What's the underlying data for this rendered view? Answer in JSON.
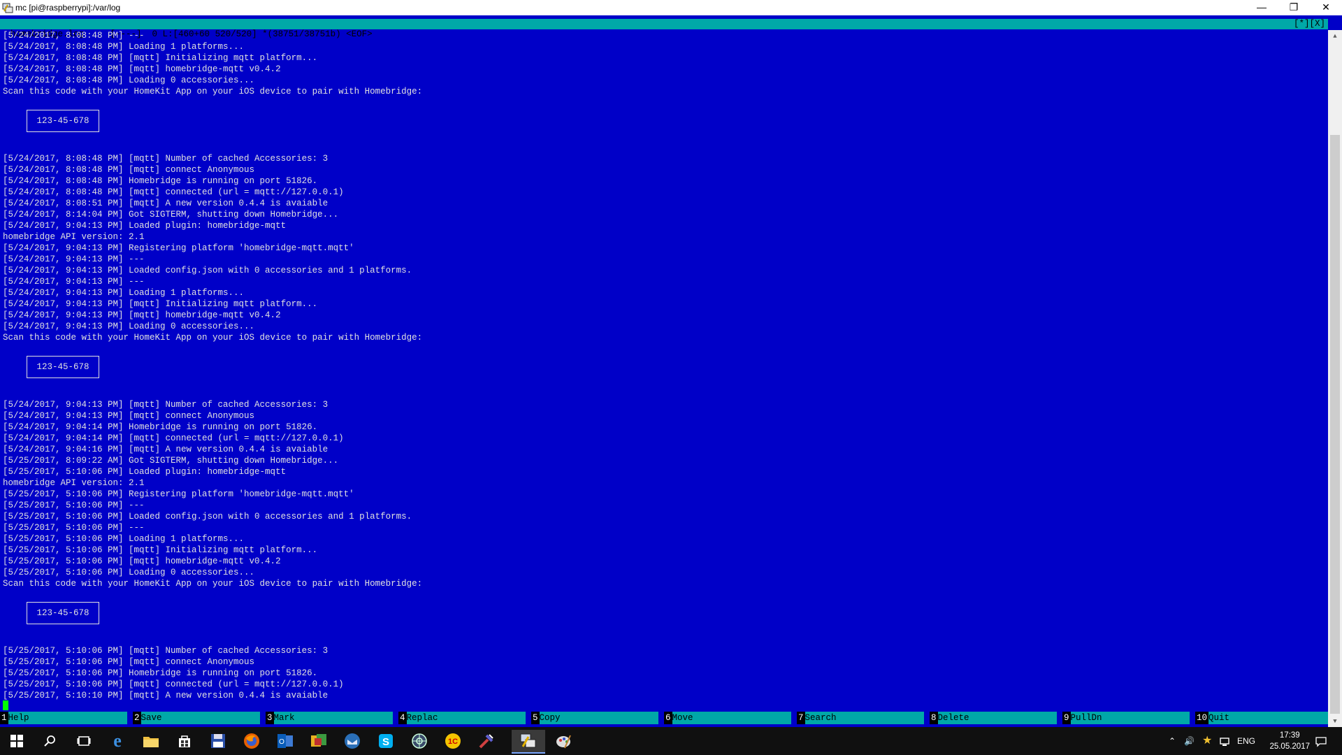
{
  "window": {
    "title": "mc [pi@raspberrypi]:/var/log",
    "controls": [
      "minimize",
      "restore",
      "close"
    ]
  },
  "status": {
    "left": "homebridge.log     [----]  0 L:[460+60 520/520] *(38751/38751b) <EOF>",
    "right": "[*][X]"
  },
  "log": [
    {
      "t": "[5/24/2017, 8:08:48 PM] ---"
    },
    {
      "t": "[5/24/2017, 8:08:48 PM] Loading 1 platforms..."
    },
    {
      "t": "[5/24/2017, 8:08:48 PM] [mqtt] Initializing mqtt platform..."
    },
    {
      "t": "[5/24/2017, 8:08:48 PM] [mqtt] homebridge-mqtt v0.4.2"
    },
    {
      "t": "[5/24/2017, 8:08:48 PM] Loading 0 accessories..."
    },
    {
      "t": "Scan this code with your HomeKit App on your iOS device to pair with Homebridge:"
    },
    {
      "qr": "123-45-678"
    },
    {
      "t": "[5/24/2017, 8:08:48 PM] [mqtt] Number of cached Accessories: 3"
    },
    {
      "t": "[5/24/2017, 8:08:48 PM] [mqtt] connect Anonymous"
    },
    {
      "t": "[5/24/2017, 8:08:48 PM] Homebridge is running on port 51826."
    },
    {
      "t": "[5/24/2017, 8:08:48 PM] [mqtt] connected (url = mqtt://127.0.0.1)"
    },
    {
      "t": "[5/24/2017, 8:08:51 PM] [mqtt] A new version 0.4.4 is avaiable"
    },
    {
      "t": "[5/24/2017, 8:14:04 PM] Got SIGTERM, shutting down Homebridge..."
    },
    {
      "t": "[5/24/2017, 9:04:13 PM] Loaded plugin: homebridge-mqtt"
    },
    {
      "t": "homebridge API version: 2.1"
    },
    {
      "t": "[5/24/2017, 9:04:13 PM] Registering platform 'homebridge-mqtt.mqtt'"
    },
    {
      "t": "[5/24/2017, 9:04:13 PM] ---"
    },
    {
      "t": "[5/24/2017, 9:04:13 PM] Loaded config.json with 0 accessories and 1 platforms."
    },
    {
      "t": "[5/24/2017, 9:04:13 PM] ---"
    },
    {
      "t": "[5/24/2017, 9:04:13 PM] Loading 1 platforms..."
    },
    {
      "t": "[5/24/2017, 9:04:13 PM] [mqtt] Initializing mqtt platform..."
    },
    {
      "t": "[5/24/2017, 9:04:13 PM] [mqtt] homebridge-mqtt v0.4.2"
    },
    {
      "t": "[5/24/2017, 9:04:13 PM] Loading 0 accessories..."
    },
    {
      "t": "Scan this code with your HomeKit App on your iOS device to pair with Homebridge:"
    },
    {
      "qr": "123-45-678"
    },
    {
      "t": "[5/24/2017, 9:04:13 PM] [mqtt] Number of cached Accessories: 3"
    },
    {
      "t": "[5/24/2017, 9:04:13 PM] [mqtt] connect Anonymous"
    },
    {
      "t": "[5/24/2017, 9:04:14 PM] Homebridge is running on port 51826."
    },
    {
      "t": "[5/24/2017, 9:04:14 PM] [mqtt] connected (url = mqtt://127.0.0.1)"
    },
    {
      "t": "[5/24/2017, 9:04:16 PM] [mqtt] A new version 0.4.4 is avaiable"
    },
    {
      "t": "[5/25/2017, 8:09:22 AM] Got SIGTERM, shutting down Homebridge..."
    },
    {
      "t": "[5/25/2017, 5:10:06 PM] Loaded plugin: homebridge-mqtt"
    },
    {
      "t": "homebridge API version: 2.1"
    },
    {
      "t": "[5/25/2017, 5:10:06 PM] Registering platform 'homebridge-mqtt.mqtt'"
    },
    {
      "t": "[5/25/2017, 5:10:06 PM] ---"
    },
    {
      "t": "[5/25/2017, 5:10:06 PM] Loaded config.json with 0 accessories and 1 platforms."
    },
    {
      "t": "[5/25/2017, 5:10:06 PM] ---"
    },
    {
      "t": "[5/25/2017, 5:10:06 PM] Loading 1 platforms..."
    },
    {
      "t": "[5/25/2017, 5:10:06 PM] [mqtt] Initializing mqtt platform..."
    },
    {
      "t": "[5/25/2017, 5:10:06 PM] [mqtt] homebridge-mqtt v0.4.2"
    },
    {
      "t": "[5/25/2017, 5:10:06 PM] Loading 0 accessories..."
    },
    {
      "t": "Scan this code with your HomeKit App on your iOS device to pair with Homebridge:"
    },
    {
      "qr": "123-45-678"
    },
    {
      "t": "[5/25/2017, 5:10:06 PM] [mqtt] Number of cached Accessories: 3"
    },
    {
      "t": "[5/25/2017, 5:10:06 PM] [mqtt] connect Anonymous"
    },
    {
      "t": "[5/25/2017, 5:10:06 PM] Homebridge is running on port 51826."
    },
    {
      "t": "[5/25/2017, 5:10:06 PM] [mqtt] connected (url = mqtt://127.0.0.1)"
    },
    {
      "t": "[5/25/2017, 5:10:10 PM] [mqtt] A new version 0.4.4 is avaiable"
    }
  ],
  "fkeys": [
    {
      "num": "1",
      "label": "Help"
    },
    {
      "num": "2",
      "label": "Save"
    },
    {
      "num": "3",
      "label": "Mark"
    },
    {
      "num": "4",
      "label": "Replac"
    },
    {
      "num": "5",
      "label": "Copy"
    },
    {
      "num": "6",
      "label": "Move"
    },
    {
      "num": "7",
      "label": "Search"
    },
    {
      "num": "8",
      "label": "Delete"
    },
    {
      "num": "9",
      "label": "PullDn"
    },
    {
      "num": "10",
      "label": "Quit"
    }
  ],
  "taskbar": {
    "language": "ENG",
    "time": "17:39",
    "date": "25.05.2017"
  },
  "colors": {
    "editor_bg": "#0000c8",
    "bar_cyan": "#00a8a8",
    "cursor": "#00ff00"
  }
}
